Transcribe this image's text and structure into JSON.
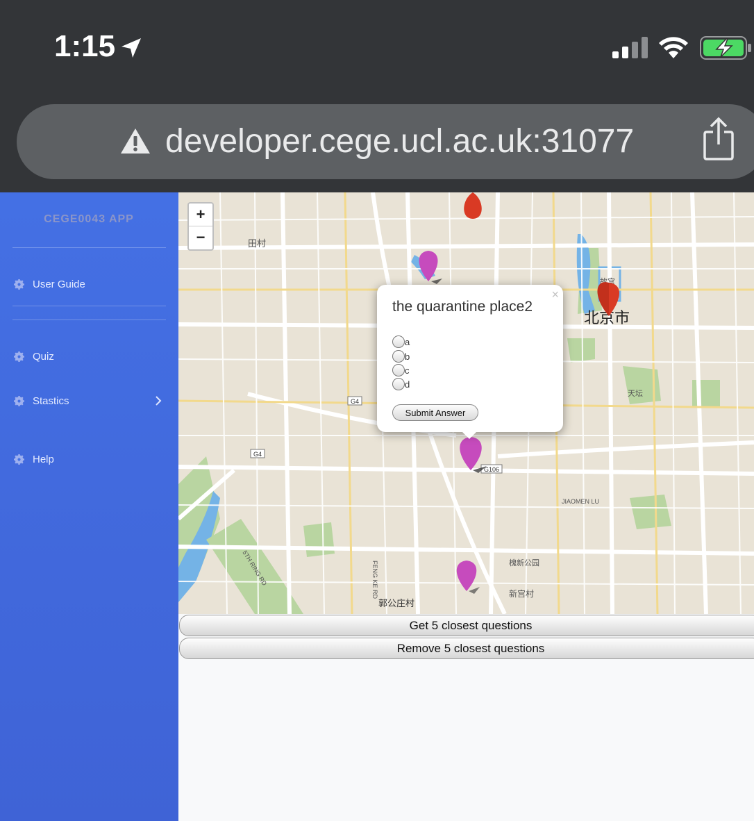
{
  "status_bar": {
    "time": "1:15"
  },
  "browser": {
    "url": "developer.cege.ucl.ac.uk:31077"
  },
  "sidebar": {
    "brand": "CEGE0043 APP",
    "items": [
      {
        "label": "User Guide"
      },
      {
        "label": "Quiz"
      },
      {
        "label": "Stastics"
      },
      {
        "label": "Help"
      }
    ]
  },
  "map": {
    "zoom_in": "+",
    "zoom_out": "−",
    "labels": [
      "北京市",
      "田村",
      "故宫",
      "天坛",
      "新宫村",
      "郭公庄村",
      "G4",
      "G106",
      "JIAOMEN LU",
      "5TH RING RD",
      "FENG KE RD"
    ],
    "popup": {
      "title": "the quarantine place2",
      "options": [
        "a",
        "b",
        "c",
        "d"
      ],
      "submit_label": "Submit Answer",
      "close": "×"
    },
    "marker_colors": {
      "red": "#d93a24",
      "magenta": "#c64bbd"
    }
  },
  "buttons": {
    "get": "Get 5 closest questions",
    "remove": "Remove 5 closest questions"
  }
}
